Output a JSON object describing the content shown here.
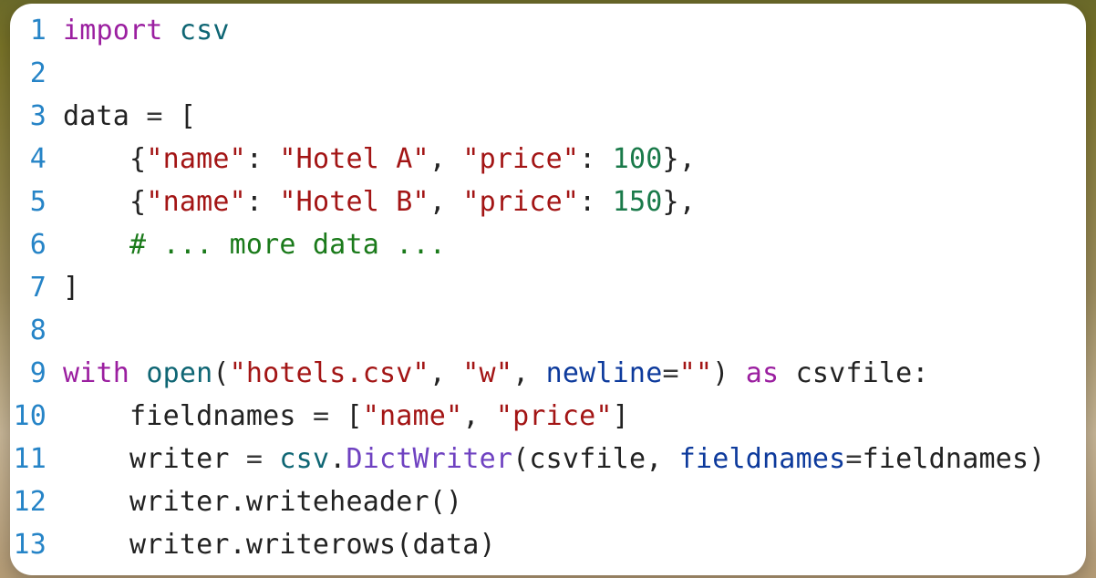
{
  "code": {
    "language": "python",
    "lines": [
      {
        "n": "1",
        "tokens": [
          [
            "tk-kw",
            "import"
          ],
          [
            "tk-def",
            " "
          ],
          [
            "tk-mod",
            "csv"
          ]
        ]
      },
      {
        "n": "2",
        "tokens": [
          [
            "tk-def",
            ""
          ]
        ]
      },
      {
        "n": "3",
        "tokens": [
          [
            "tk-def",
            "data "
          ],
          [
            "tk-op",
            "="
          ],
          [
            "tk-def",
            " ["
          ]
        ]
      },
      {
        "n": "4",
        "tokens": [
          [
            "tk-def",
            "    {"
          ],
          [
            "tk-str",
            "\"name\""
          ],
          [
            "tk-def",
            ": "
          ],
          [
            "tk-str",
            "\"Hotel A\""
          ],
          [
            "tk-def",
            ", "
          ],
          [
            "tk-str",
            "\"price\""
          ],
          [
            "tk-def",
            ": "
          ],
          [
            "tk-num",
            "100"
          ],
          [
            "tk-def",
            "},"
          ]
        ]
      },
      {
        "n": "5",
        "tokens": [
          [
            "tk-def",
            "    {"
          ],
          [
            "tk-str",
            "\"name\""
          ],
          [
            "tk-def",
            ": "
          ],
          [
            "tk-str",
            "\"Hotel B\""
          ],
          [
            "tk-def",
            ", "
          ],
          [
            "tk-str",
            "\"price\""
          ],
          [
            "tk-def",
            ": "
          ],
          [
            "tk-num",
            "150"
          ],
          [
            "tk-def",
            "},"
          ]
        ]
      },
      {
        "n": "6",
        "tokens": [
          [
            "tk-def",
            "    "
          ],
          [
            "tk-cmt",
            "# ... more data ..."
          ]
        ]
      },
      {
        "n": "7",
        "tokens": [
          [
            "tk-def",
            "]"
          ]
        ]
      },
      {
        "n": "8",
        "tokens": [
          [
            "tk-def",
            ""
          ]
        ]
      },
      {
        "n": "9",
        "tokens": [
          [
            "tk-kw",
            "with"
          ],
          [
            "tk-def",
            " "
          ],
          [
            "tk-mod",
            "open"
          ],
          [
            "tk-def",
            "("
          ],
          [
            "tk-str",
            "\"hotels.csv\""
          ],
          [
            "tk-def",
            ", "
          ],
          [
            "tk-str",
            "\"w\""
          ],
          [
            "tk-def",
            ", "
          ],
          [
            "tk-blue",
            "newline"
          ],
          [
            "tk-op",
            "="
          ],
          [
            "tk-str",
            "\"\""
          ],
          [
            "tk-def",
            ") "
          ],
          [
            "tk-kw",
            "as"
          ],
          [
            "tk-def",
            " csvfile:"
          ]
        ]
      },
      {
        "n": "10",
        "tokens": [
          [
            "tk-def",
            "    fieldnames "
          ],
          [
            "tk-op",
            "="
          ],
          [
            "tk-def",
            " ["
          ],
          [
            "tk-str",
            "\"name\""
          ],
          [
            "tk-def",
            ", "
          ],
          [
            "tk-str",
            "\"price\""
          ],
          [
            "tk-def",
            "]"
          ]
        ]
      },
      {
        "n": "11",
        "tokens": [
          [
            "tk-def",
            "    writer "
          ],
          [
            "tk-op",
            "="
          ],
          [
            "tk-def",
            " "
          ],
          [
            "tk-mod",
            "csv"
          ],
          [
            "tk-def",
            "."
          ],
          [
            "tk-fn",
            "DictWriter"
          ],
          [
            "tk-def",
            "(csvfile, "
          ],
          [
            "tk-blue",
            "fieldnames"
          ],
          [
            "tk-op",
            "="
          ],
          [
            "tk-def",
            "fieldnames)"
          ]
        ]
      },
      {
        "n": "12",
        "tokens": [
          [
            "tk-def",
            "    writer.writeheader()"
          ]
        ]
      },
      {
        "n": "13",
        "tokens": [
          [
            "tk-def",
            "    writer.writerows(data)"
          ]
        ]
      }
    ]
  }
}
